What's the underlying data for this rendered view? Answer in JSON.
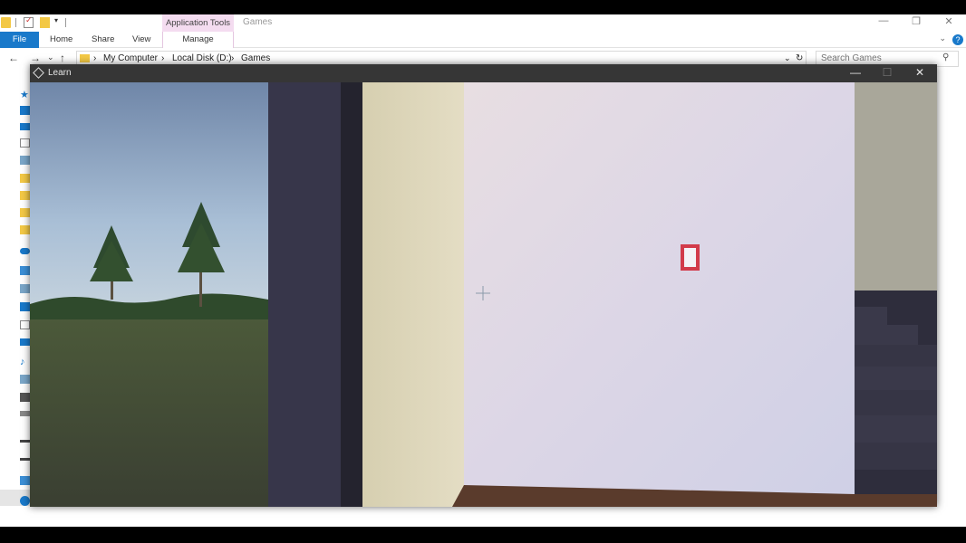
{
  "explorer": {
    "window_title": "Games",
    "context_tab": "Application Tools",
    "ribbon_tabs": {
      "file": "File",
      "home": "Home",
      "share": "Share",
      "view": "View",
      "manage": "Manage"
    },
    "breadcrumb": [
      "My Computer",
      "Local Disk (D:)",
      "Games"
    ],
    "search_placeholder": "Search Games",
    "glyphs": {
      "back": "←",
      "forward": "→",
      "recent": "⌄",
      "up": "↑",
      "sep": "›",
      "minimize": "—",
      "restore": "❐",
      "close": "✕",
      "dropdown": "⌄",
      "refresh": "↻",
      "search": "⚲",
      "qa_dropdown": "▾",
      "help": "?"
    }
  },
  "game": {
    "title": "Learn",
    "glyphs": {
      "minimize": "—",
      "maximize": "☐",
      "close": "✕"
    }
  },
  "colors": {
    "accent": "#1979ca",
    "context_tab_bg": "#f4dcf0",
    "game_titlebar": "#363636",
    "interact_marker": "#d23b4a"
  }
}
